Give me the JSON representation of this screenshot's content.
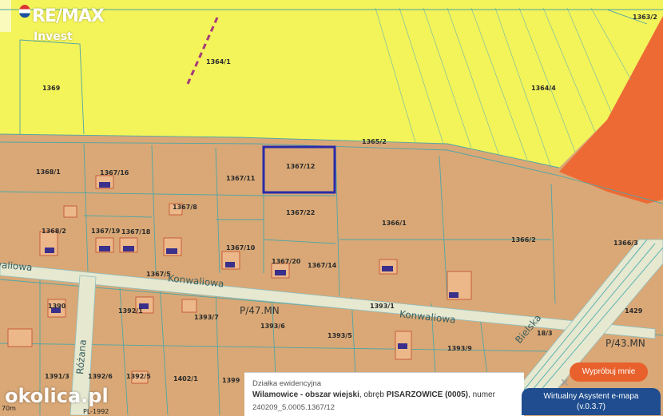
{
  "logo": {
    "brand": "RE/MAX",
    "sub": "Invest"
  },
  "watermark": "okolica.pl",
  "scale_label": "70m",
  "crs_label": "PL-1992",
  "parcels": [
    {
      "id": "1364-1",
      "text": "1364/1"
    },
    {
      "id": "1369",
      "text": "1369"
    },
    {
      "id": "1364-4",
      "text": "1364/4"
    },
    {
      "id": "1363-2",
      "text": "1363/2"
    },
    {
      "id": "1365-2",
      "text": "1365/2"
    },
    {
      "id": "1368-1",
      "text": "1368/1"
    },
    {
      "id": "1367-16",
      "text": "1367/16"
    },
    {
      "id": "1367-11",
      "text": "1367/11"
    },
    {
      "id": "1367-12",
      "text": "1367/12"
    },
    {
      "id": "1367-8",
      "text": "1367/8"
    },
    {
      "id": "1367-22",
      "text": "1367/22"
    },
    {
      "id": "1366-1",
      "text": "1366/1"
    },
    {
      "id": "1368-2",
      "text": "1368/2"
    },
    {
      "id": "1367-19",
      "text": "1367/19"
    },
    {
      "id": "1367-18",
      "text": "1367/18"
    },
    {
      "id": "1366-2",
      "text": "1366/2"
    },
    {
      "id": "1366-3",
      "text": "1366/3"
    },
    {
      "id": "1367-10",
      "text": "1367/10"
    },
    {
      "id": "1367-20",
      "text": "1367/20"
    },
    {
      "id": "1367-14",
      "text": "1367/14"
    },
    {
      "id": "1367-5",
      "text": "1367/5"
    },
    {
      "id": "1390",
      "text": "1390"
    },
    {
      "id": "1392-1",
      "text": "1392/1"
    },
    {
      "id": "1393-7",
      "text": "1393/7"
    },
    {
      "id": "1393-1",
      "text": "1393/1"
    },
    {
      "id": "1429",
      "text": "1429"
    },
    {
      "id": "1393-6",
      "text": "1393/6"
    },
    {
      "id": "1393-5",
      "text": "1393/5"
    },
    {
      "id": "1393-9",
      "text": "1393/9"
    },
    {
      "id": "18-3",
      "text": "18/3"
    },
    {
      "id": "1391-3",
      "text": "1391/3"
    },
    {
      "id": "1392-6",
      "text": "1392/6"
    },
    {
      "id": "1392-5",
      "text": "1392/5"
    },
    {
      "id": "1402-1",
      "text": "1402/1"
    },
    {
      "id": "1399",
      "text": "1399"
    }
  ],
  "streets": {
    "konwaliowa_1": "Konwaliowa",
    "konwaliowa_2": "Konwaliowa",
    "konwaliowa_left": "Konwaliowa",
    "rozana": "Różana",
    "bielska": "Bielska"
  },
  "zones": {
    "p47": "P/47.MN",
    "p43": "P/43.MN"
  },
  "highlighted_parcel": "1367/12",
  "popup": {
    "title": "Działka ewidencyjna",
    "location_bold": "Wilamowice - obszar wiejski",
    "precinct_prefix": ", obręb ",
    "precinct_bold": "PISARZOWICE (0005)",
    "number_prefix": ", numer",
    "parcel_code": "240209_5.0005.1367/12"
  },
  "buttons": {
    "close": "✕",
    "try": "Wypróbuj mnie",
    "assistant_line1": "Wirtualny Asystent e-mapa",
    "assistant_line2": "(v.0.3.7)"
  },
  "colors": {
    "residential": "#d9a876",
    "agricultural": "#f3f35a",
    "industrial": "#ee6a35",
    "road": "#e6e8d0",
    "highlight": "#2a2aa8"
  }
}
